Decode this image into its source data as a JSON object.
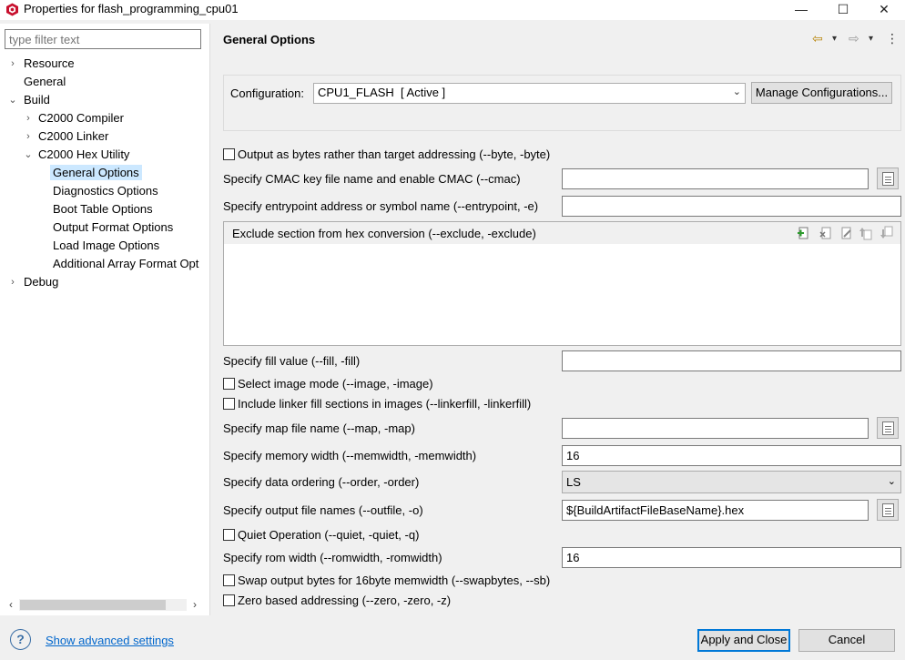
{
  "window": {
    "title": "Properties for flash_programming_cpu01",
    "min_label": "—",
    "max_label": "☐",
    "close_label": "✕"
  },
  "filter": {
    "placeholder": "type filter text"
  },
  "tree": [
    {
      "label": "Resource",
      "chevron": "›"
    },
    {
      "label": "General",
      "chevron": ""
    },
    {
      "label": "Build",
      "chevron": "⌄"
    },
    {
      "label": "C2000 Compiler",
      "chevron": "›"
    },
    {
      "label": "C2000 Linker",
      "chevron": "›"
    },
    {
      "label": "C2000 Hex Utility",
      "chevron": "⌄"
    },
    {
      "label": "General Options",
      "chevron": ""
    },
    {
      "label": "Diagnostics Options",
      "chevron": ""
    },
    {
      "label": "Boot Table Options",
      "chevron": ""
    },
    {
      "label": "Output Format Options",
      "chevron": ""
    },
    {
      "label": "Load Image Options",
      "chevron": ""
    },
    {
      "label": "Additional Array Format Opt",
      "chevron": ""
    },
    {
      "label": "Debug",
      "chevron": "›"
    }
  ],
  "scroll": {
    "left": "‹",
    "right": "›"
  },
  "header": {
    "title": "General Options",
    "back": "⇦",
    "forward": "⇨",
    "dropdown": "▾",
    "more": "⋮"
  },
  "config": {
    "label": "Configuration:",
    "value": "CPU1_FLASH  [ Active ]",
    "caret": "⌄",
    "manage_label": "Manage Configurations..."
  },
  "options": {
    "byte": "Output as bytes rather than target addressing (--byte, -byte)",
    "cmac": "Specify CMAC key file name and enable CMAC (--cmac)",
    "entrypoint": "Specify entrypoint address or symbol name (--entrypoint, -e)",
    "exclude": "Exclude section from hex conversion (--exclude, -exclude)",
    "fill": "Specify fill value (--fill, -fill)",
    "image": "Select image mode (--image, -image)",
    "linkerfill": "Include linker fill sections in images (--linkerfill, -linkerfill)",
    "map": "Specify map file name (--map, -map)",
    "memwidth": "Specify memory width (--memwidth, -memwidth)",
    "memwidth_value": "16",
    "order": "Specify data ordering (--order, -order)",
    "order_value": "LS",
    "outfile": "Specify output file names (--outfile, -o)",
    "outfile_value": "${BuildArtifactFileBaseName}.hex",
    "quiet": "Quiet Operation (--quiet, -quiet, -q)",
    "romwidth": "Specify rom width (--romwidth, -romwidth)",
    "romwidth_value": "16",
    "swapbytes": "Swap output bytes for 16byte memwidth (--swapbytes, --sb)",
    "zero": "Zero based addressing (--zero, -zero, -z)"
  },
  "footer": {
    "help": "?",
    "advanced": "Show advanced settings",
    "apply_close": "Apply and Close",
    "cancel": "Cancel"
  }
}
